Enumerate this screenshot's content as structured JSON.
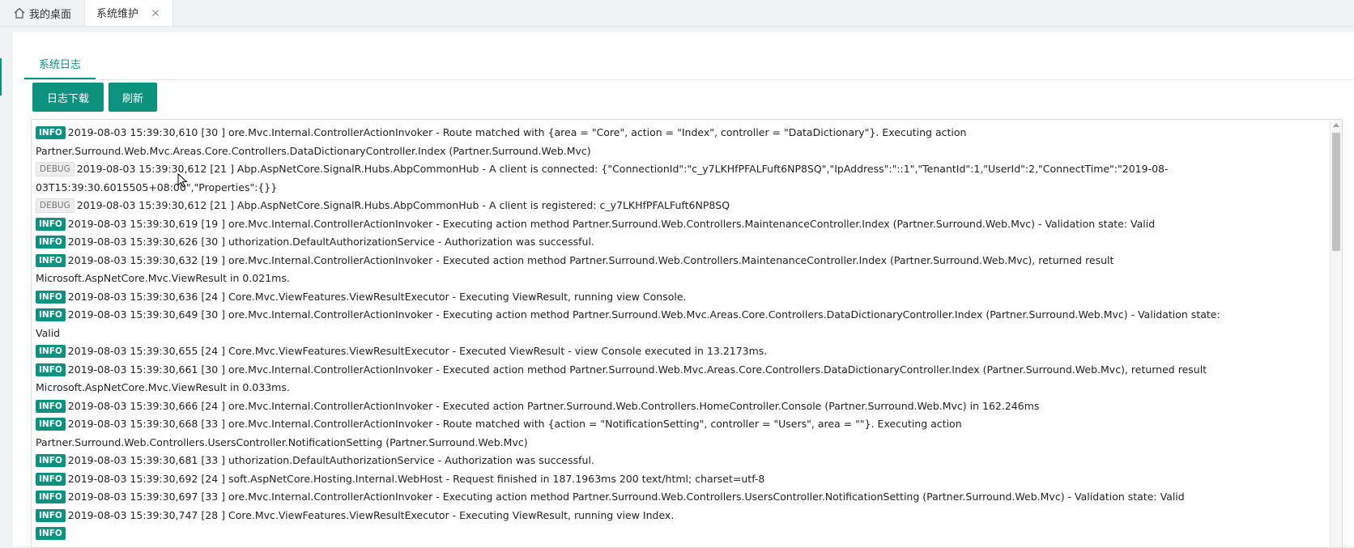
{
  "tabbar": {
    "home_label": "我的桌面",
    "active_label": "系统维护"
  },
  "subtab": {
    "label": "系统日志"
  },
  "toolbar": {
    "download_label": "日志下载",
    "refresh_label": "刷新"
  },
  "colors": {
    "accent": "#0e9280"
  },
  "logs": [
    {
      "level": "INFO",
      "text": "2019-08-03 15:39:30,610 [30 ] ore.Mvc.Internal.ControllerActionInvoker - Route matched with {area = \"Core\", action = \"Index\", controller = \"DataDictionary\"}. Executing action Partner.Surround.Web.Mvc.Areas.Core.Controllers.DataDictionaryController.Index (Partner.Surround.Web.Mvc)"
    },
    {
      "level": "DEBUG",
      "text": "2019-08-03 15:39:30,612 [21 ] Abp.AspNetCore.SignalR.Hubs.AbpCommonHub - A client is connected: {\"ConnectionId\":\"c_y7LKHfPFALFuft6NP8SQ\",\"IpAddress\":\"::1\",\"TenantId\":1,\"UserId\":2,\"ConnectTime\":\"2019-08-03T15:39:30.6015505+08:00\",\"Properties\":{}}"
    },
    {
      "level": "DEBUG",
      "text": "2019-08-03 15:39:30,612 [21 ] Abp.AspNetCore.SignalR.Hubs.AbpCommonHub - A client is registered: c_y7LKHfPFALFuft6NP8SQ"
    },
    {
      "level": "INFO",
      "text": "2019-08-03 15:39:30,619 [19 ] ore.Mvc.Internal.ControllerActionInvoker - Executing action method Partner.Surround.Web.Controllers.MaintenanceController.Index (Partner.Surround.Web.Mvc) - Validation state: Valid"
    },
    {
      "level": "INFO",
      "text": "2019-08-03 15:39:30,626 [30 ] uthorization.DefaultAuthorizationService - Authorization was successful."
    },
    {
      "level": "INFO",
      "text": "2019-08-03 15:39:30,632 [19 ] ore.Mvc.Internal.ControllerActionInvoker - Executed action method Partner.Surround.Web.Controllers.MaintenanceController.Index (Partner.Surround.Web.Mvc), returned result Microsoft.AspNetCore.Mvc.ViewResult in 0.021ms."
    },
    {
      "level": "INFO",
      "text": "2019-08-03 15:39:30,636 [24 ] Core.Mvc.ViewFeatures.ViewResultExecutor - Executing ViewResult, running view Console."
    },
    {
      "level": "INFO",
      "text": "2019-08-03 15:39:30,649 [30 ] ore.Mvc.Internal.ControllerActionInvoker - Executing action method Partner.Surround.Web.Mvc.Areas.Core.Controllers.DataDictionaryController.Index (Partner.Surround.Web.Mvc) - Validation state: Valid"
    },
    {
      "level": "INFO",
      "text": "2019-08-03 15:39:30,655 [24 ] Core.Mvc.ViewFeatures.ViewResultExecutor - Executed ViewResult - view Console executed in 13.2173ms."
    },
    {
      "level": "INFO",
      "text": "2019-08-03 15:39:30,661 [30 ] ore.Mvc.Internal.ControllerActionInvoker - Executed action method Partner.Surround.Web.Mvc.Areas.Core.Controllers.DataDictionaryController.Index (Partner.Surround.Web.Mvc), returned result Microsoft.AspNetCore.Mvc.ViewResult in 0.033ms."
    },
    {
      "level": "INFO",
      "text": "2019-08-03 15:39:30,666 [24 ] ore.Mvc.Internal.ControllerActionInvoker - Executed action Partner.Surround.Web.Controllers.HomeController.Console (Partner.Surround.Web.Mvc) in 162.246ms"
    },
    {
      "level": "INFO",
      "text": "2019-08-03 15:39:30,668 [33 ] ore.Mvc.Internal.ControllerActionInvoker - Route matched with {action = \"NotificationSetting\", controller = \"Users\", area = \"\"}. Executing action Partner.Surround.Web.Controllers.UsersController.NotificationSetting (Partner.Surround.Web.Mvc)"
    },
    {
      "level": "INFO",
      "text": "2019-08-03 15:39:30,681 [33 ] uthorization.DefaultAuthorizationService - Authorization was successful."
    },
    {
      "level": "INFO",
      "text": "2019-08-03 15:39:30,692 [24 ] soft.AspNetCore.Hosting.Internal.WebHost - Request finished in 187.1963ms 200 text/html; charset=utf-8"
    },
    {
      "level": "INFO",
      "text": "2019-08-03 15:39:30,697 [33 ] ore.Mvc.Internal.ControllerActionInvoker - Executing action method Partner.Surround.Web.Controllers.UsersController.NotificationSetting (Partner.Surround.Web.Mvc) - Validation state: Valid"
    },
    {
      "level": "INFO",
      "text": "2019-08-03 15:39:30,747 [28 ] Core.Mvc.ViewFeatures.ViewResultExecutor - Executing ViewResult, running view Index."
    },
    {
      "level": "INFO",
      "text": ""
    }
  ]
}
